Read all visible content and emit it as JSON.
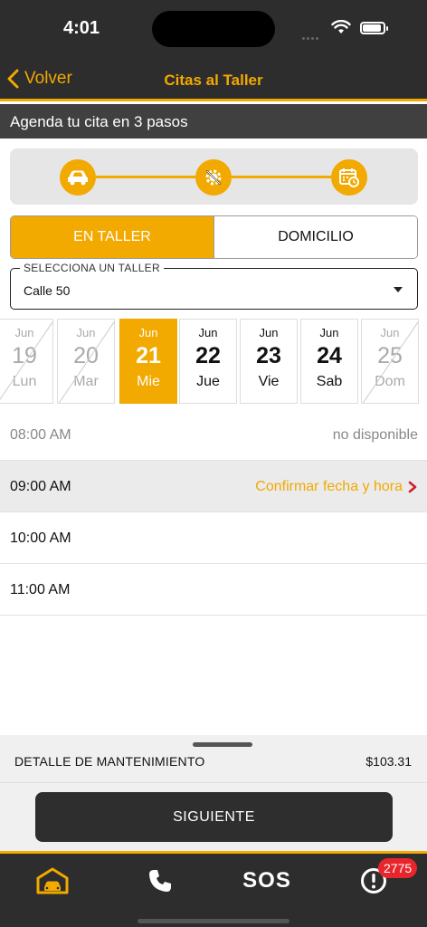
{
  "status_bar": {
    "time": "4:01"
  },
  "nav": {
    "back_label": "Volver",
    "title": "Citas al Taller"
  },
  "steps_header": "Agenda tu cita en 3 pasos",
  "stepper": {
    "icons": [
      "car-icon",
      "gear-wrench-icon",
      "calendar-clock-icon"
    ],
    "current_step": 3
  },
  "mode_toggle": {
    "options": [
      "EN TALLER",
      "DOMICILIO"
    ],
    "selected": "EN TALLER"
  },
  "workshop_select": {
    "label": "SELECCIONA UN TALLER",
    "value": "Calle 50"
  },
  "dates": [
    {
      "month": "Jun",
      "day": "19",
      "weekday": "Lun",
      "state": "disabled"
    },
    {
      "month": "Jun",
      "day": "20",
      "weekday": "Mar",
      "state": "disabled"
    },
    {
      "month": "Jun",
      "day": "21",
      "weekday": "Mie",
      "state": "selected"
    },
    {
      "month": "Jun",
      "day": "22",
      "weekday": "Jue",
      "state": "available"
    },
    {
      "month": "Jun",
      "day": "23",
      "weekday": "Vie",
      "state": "available"
    },
    {
      "month": "Jun",
      "day": "24",
      "weekday": "Sab",
      "state": "available"
    },
    {
      "month": "Jun",
      "day": "25",
      "weekday": "Dom",
      "state": "disabled"
    }
  ],
  "time_slots": [
    {
      "time": "08:00 AM",
      "status_text": "no disponible",
      "state": "unavailable"
    },
    {
      "time": "09:00 AM",
      "status_text": "Confirmar fecha y hora",
      "state": "highlight"
    },
    {
      "time": "10:00 AM",
      "status_text": "",
      "state": "available"
    },
    {
      "time": "11:00 AM",
      "status_text": "",
      "state": "available"
    }
  ],
  "detail": {
    "label": "DETALLE DE MANTENIMIENTO",
    "price": "$103.31"
  },
  "next_button": "SIGUIENTE",
  "tab_bar": {
    "sos_label": "SOS",
    "badge_count": "2775"
  },
  "colors": {
    "accent": "#f2a900",
    "dark": "#2d2d2d",
    "badge": "#e8252b"
  }
}
